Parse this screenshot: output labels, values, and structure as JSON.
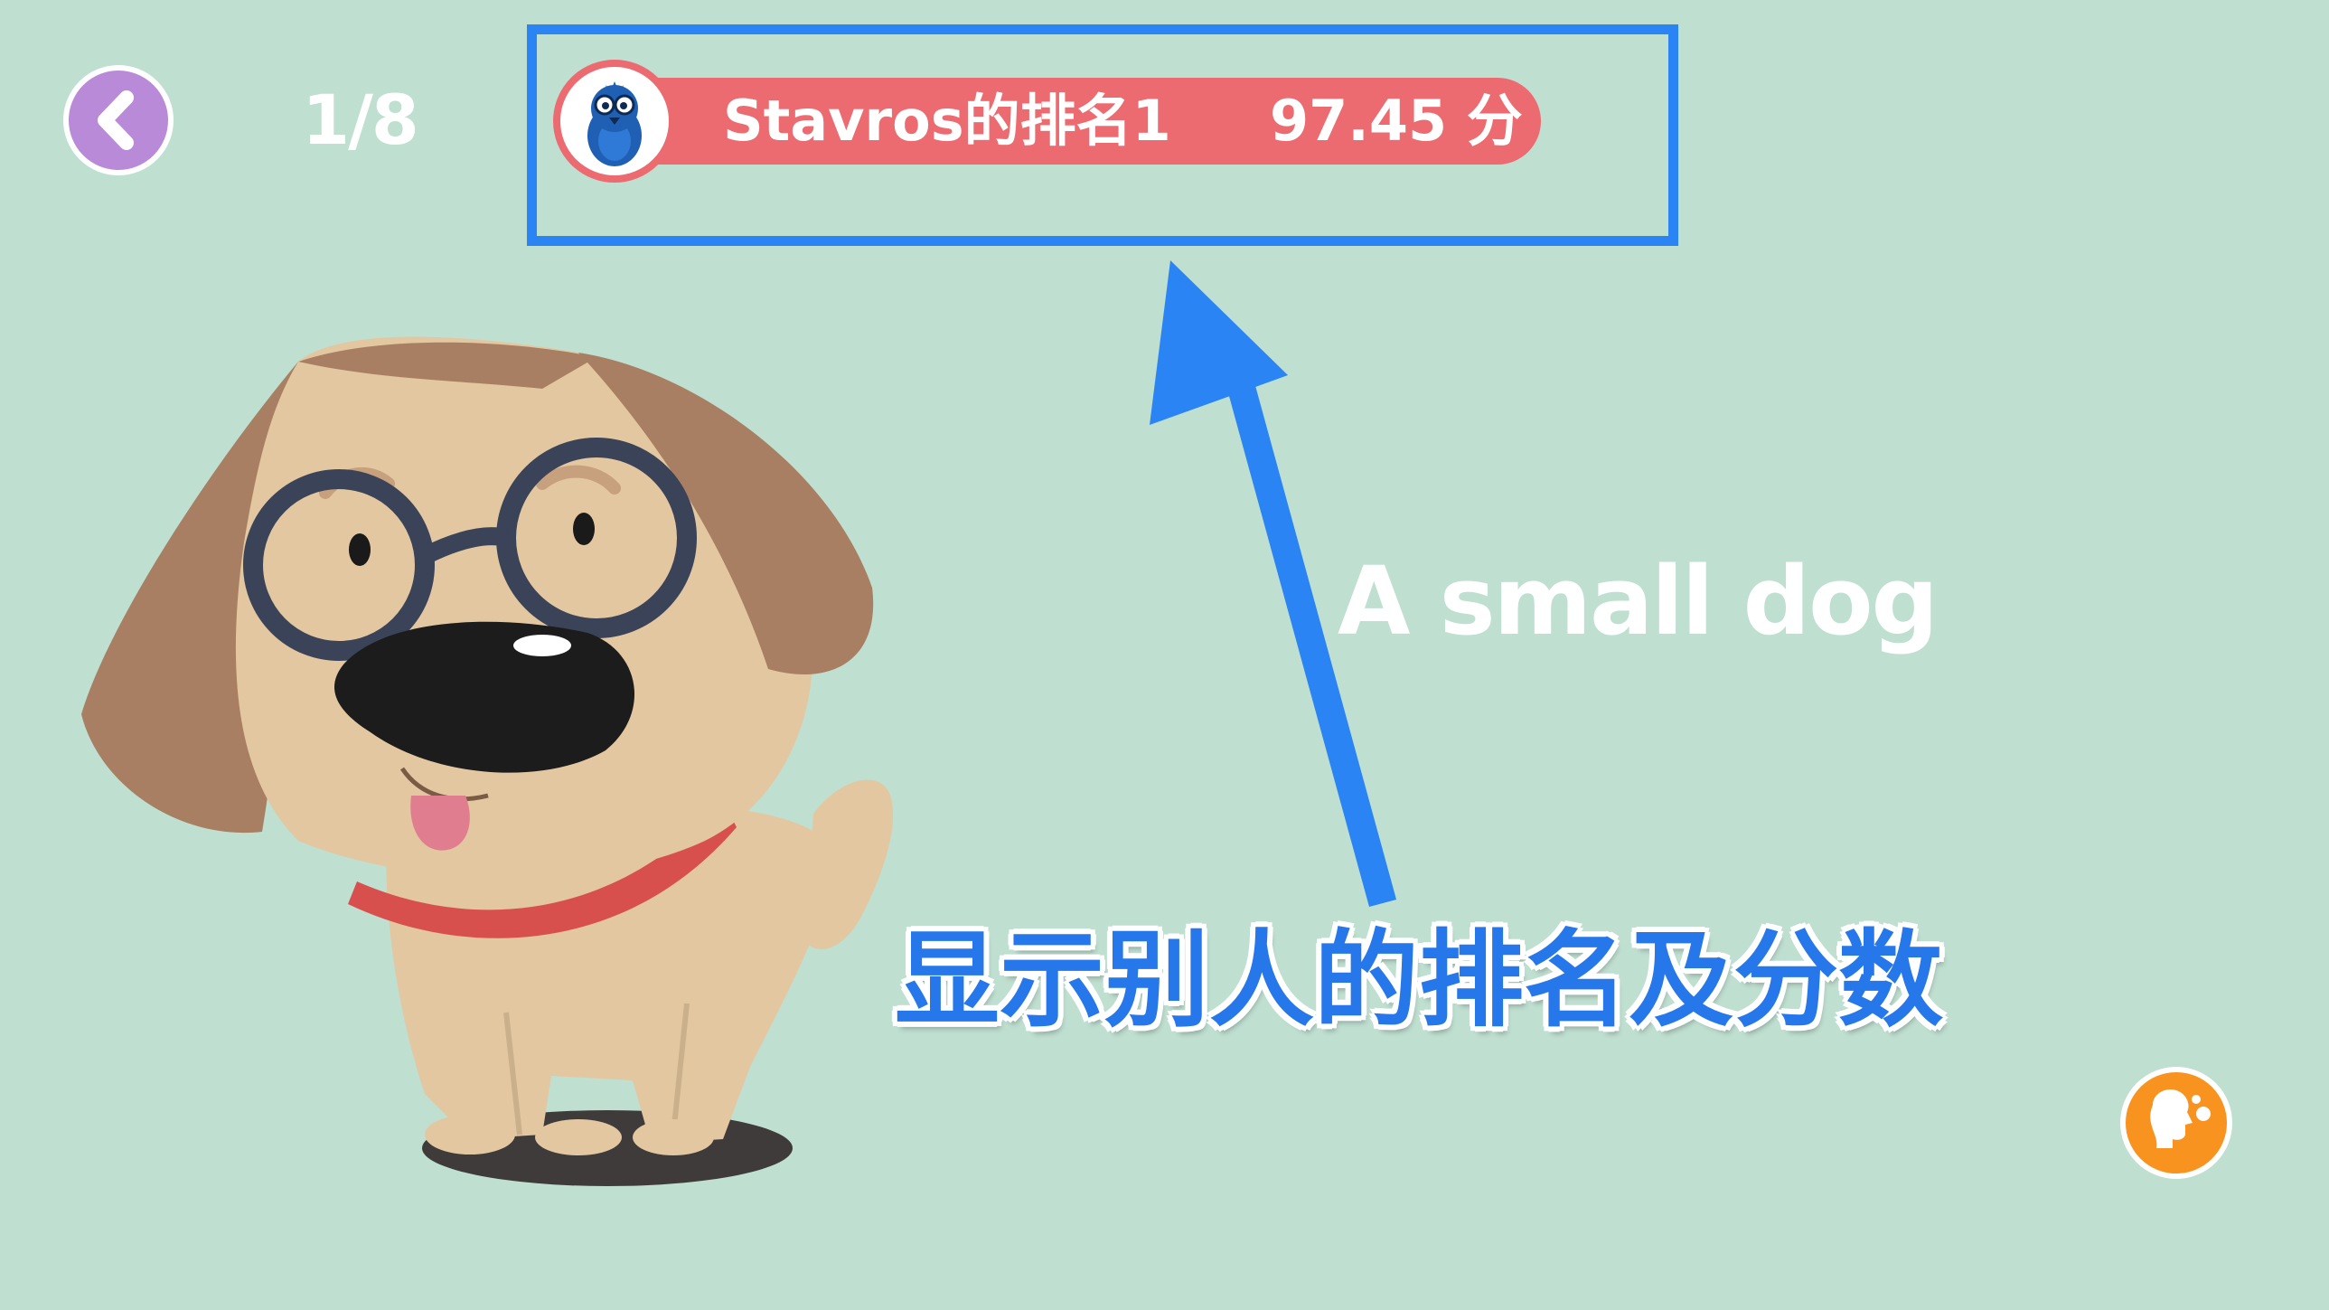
{
  "header": {
    "back_icon": "chevron-left-icon",
    "progress": "1/8",
    "rank_label": "Stavros的排名1",
    "score_label": "97.45 分",
    "avatar_icon": "blue-bird-avatar-icon"
  },
  "card": {
    "word": "A small dog",
    "illustration_icon": "dog-with-glasses-illustration"
  },
  "annotation": {
    "caption": "显示别人的排名及分数",
    "highlight_color": "#2a84f3"
  },
  "footer": {
    "speak_icon": "speaking-head-icon"
  },
  "colors": {
    "background": "#bfdfd1",
    "back_button": "#b98ad8",
    "rank_pill": "#ec6b70",
    "speak_button": "#f7931e",
    "caption_text": "#2577ea"
  }
}
